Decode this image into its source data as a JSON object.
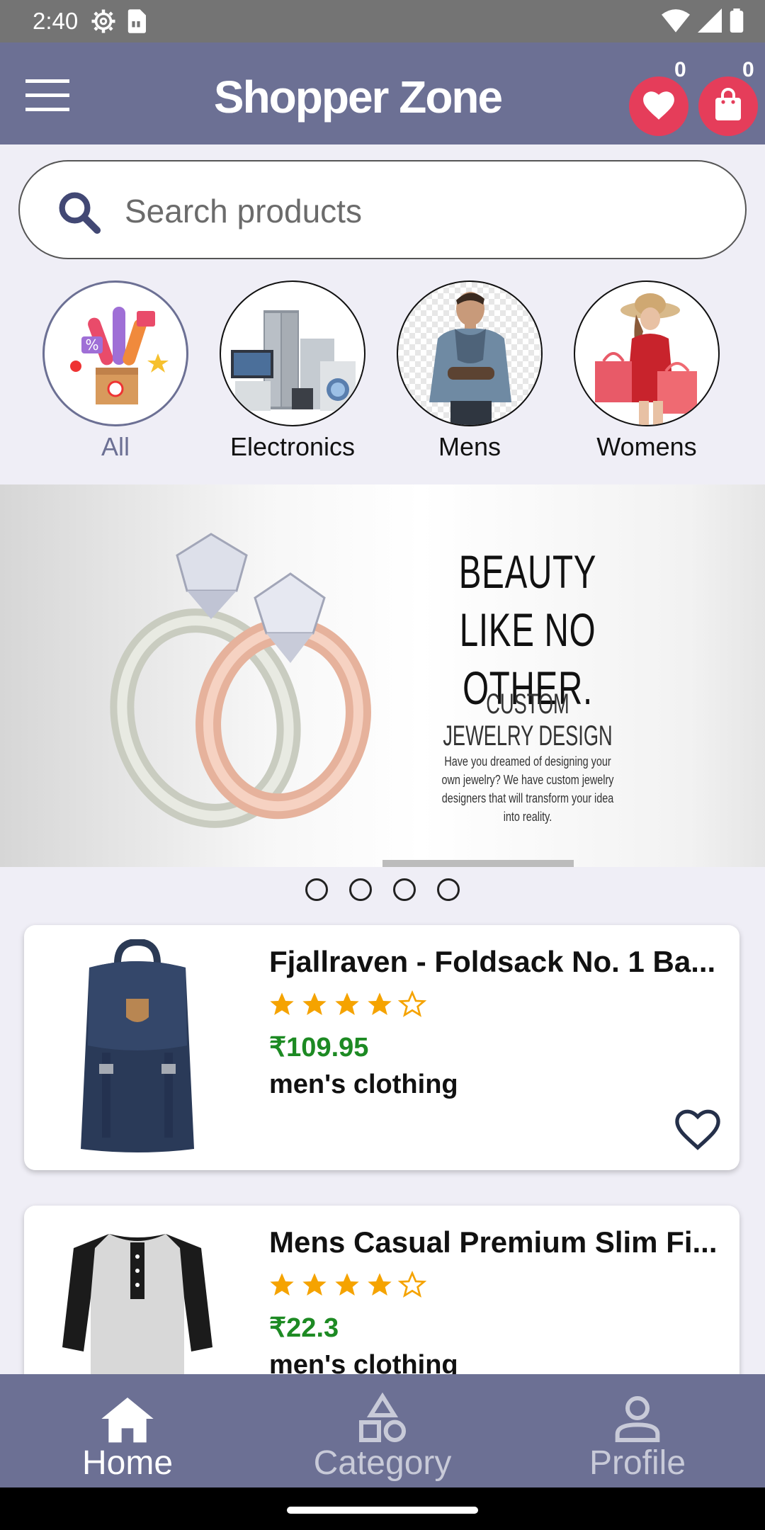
{
  "status_bar": {
    "time": "2:40",
    "icons": [
      "settings-icon",
      "sim-card-icon",
      "wifi-icon",
      "signal-icon",
      "battery-icon"
    ]
  },
  "app_bar": {
    "title": "Shopper Zone",
    "wishlist_count": "0",
    "cart_count": "0",
    "accent_color": "#6c7094",
    "badge_color": "#e53d5a"
  },
  "search": {
    "placeholder": "Search products",
    "value": ""
  },
  "categories": [
    {
      "label": "All",
      "active": true
    },
    {
      "label": "Electronics",
      "active": false
    },
    {
      "label": "Mens",
      "active": false
    },
    {
      "label": "Womens",
      "active": false
    }
  ],
  "banner": {
    "headline_1": "BEAUTY",
    "headline_2": "LIKE NO OTHER.",
    "subheading": "CUSTOM JEWELRY DESIGN",
    "body": "Have you dreamed of designing your own jewelry? We have custom jewelry designers that will transform your idea into reality.",
    "slide_count": 4
  },
  "products": [
    {
      "name": "Fjallraven - Foldsack No. 1 Ba...",
      "rating": 4,
      "max_rating": 5,
      "price": "₹109.95",
      "category": "men's clothing"
    },
    {
      "name": "Mens Casual Premium Slim Fi...",
      "rating": 4,
      "max_rating": 5,
      "price": "₹22.3",
      "category": "men's clothing"
    }
  ],
  "bottom_nav": {
    "items": [
      {
        "label": "Home",
        "icon": "home-icon",
        "active": true
      },
      {
        "label": "Category",
        "icon": "category-icon",
        "active": false
      },
      {
        "label": "Profile",
        "icon": "profile-icon",
        "active": false
      }
    ]
  }
}
